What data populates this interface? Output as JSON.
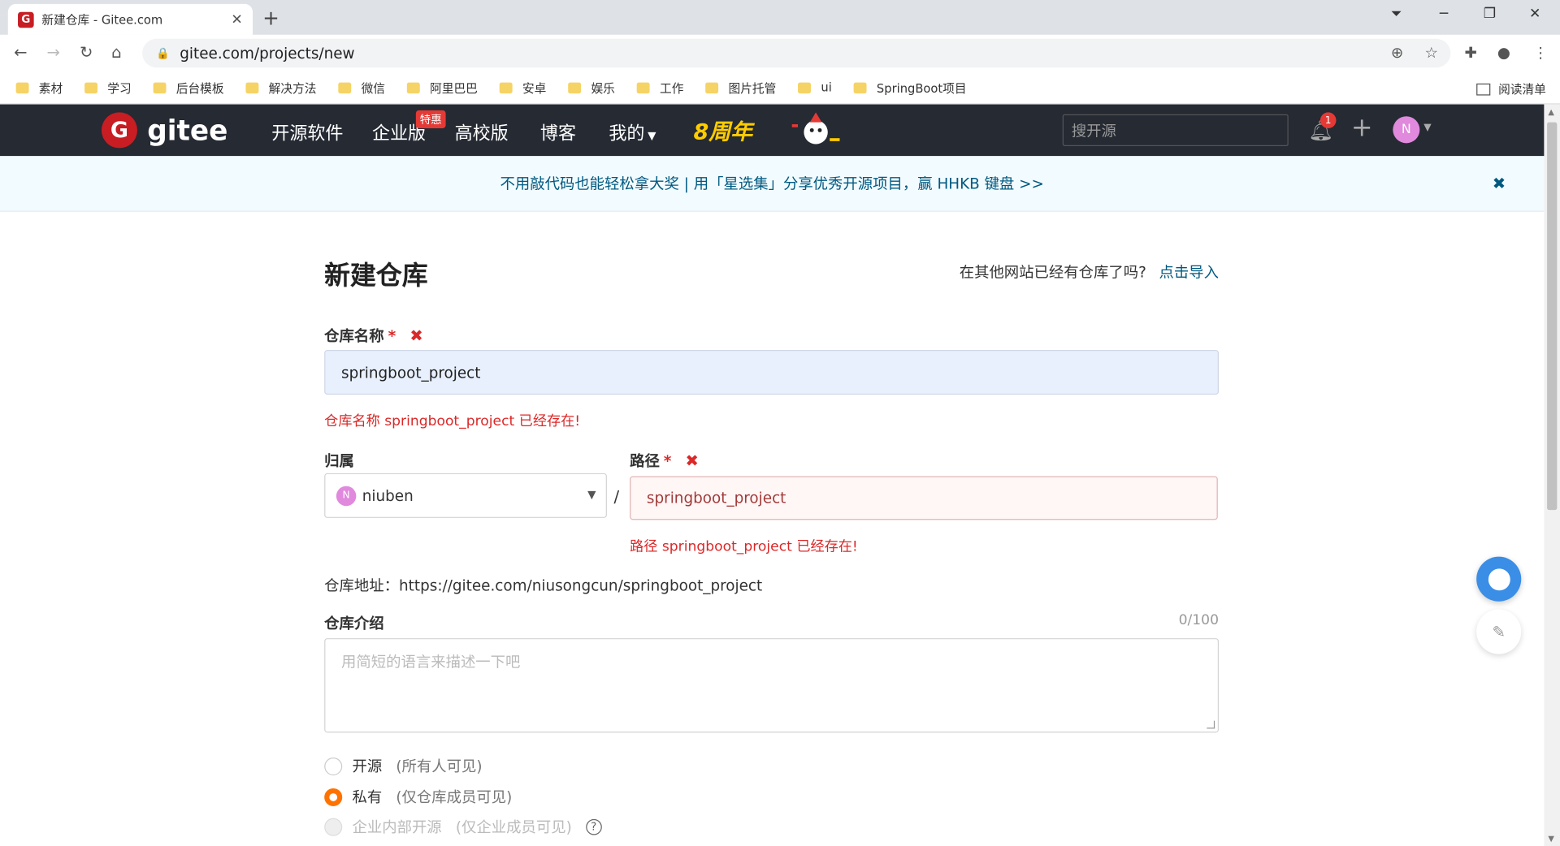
{
  "browser": {
    "tab_title": "新建仓库 - Gitee.com",
    "url": "gitee.com/projects/new",
    "bookmarks": [
      "素材",
      "学习",
      "后台模板",
      "解决方法",
      "微信",
      "阿里巴巴",
      "安卓",
      "娱乐",
      "工作",
      "图片托管",
      "ui",
      "SpringBoot项目"
    ],
    "reading_list": "阅读清单"
  },
  "header": {
    "logo_text": "gitee",
    "logo_glyph": "G",
    "nav": [
      "开源软件",
      "企业版",
      "高校版",
      "博客",
      "我的"
    ],
    "special_badge": "特惠",
    "anniversary": "8周年",
    "search_placeholder": "搜开源",
    "notification_count": "1",
    "user_initial": "N"
  },
  "banner": {
    "text": "不用敲代码也能轻松拿大奖 | 用「星选集」分享优秀开源项目，赢 HHKB 键盘 >>",
    "close": "✖"
  },
  "form": {
    "title": "新建仓库",
    "import_question": "在其他网站已经有仓库了吗?",
    "import_link": "点击导入",
    "repo_name_label": "仓库名称",
    "required_mark": "*",
    "repo_name_value": "springboot_project",
    "repo_name_error": "仓库名称 springboot_project 已经存在!",
    "owner_label": "归属",
    "owner_value": "niuben",
    "owner_initial": "N",
    "path_label": "路径",
    "path_value": "springboot_project",
    "path_error": "路径 springboot_project 已经存在!",
    "repo_url_label": "仓库地址：",
    "repo_url": "https://gitee.com/niusongcun/springboot_project",
    "description_label": "仓库介绍",
    "description_counter": "0/100",
    "description_placeholder": "用简短的语言来描述一下吧",
    "visibility": [
      {
        "label": "开源",
        "hint": "(所有人可见)",
        "selected": false,
        "disabled": false
      },
      {
        "label": "私有",
        "hint": "(仅仓库成员可见)",
        "selected": true,
        "disabled": false
      },
      {
        "label": "企业内部开源",
        "hint": "(仅企业成员可见)",
        "selected": false,
        "disabled": true
      }
    ],
    "help_glyph": "?"
  },
  "colors": {
    "brand": "#c71d23",
    "header_bg": "#252a33",
    "error": "#db2828",
    "radio_active": "#fe7300",
    "link": "#005980"
  }
}
